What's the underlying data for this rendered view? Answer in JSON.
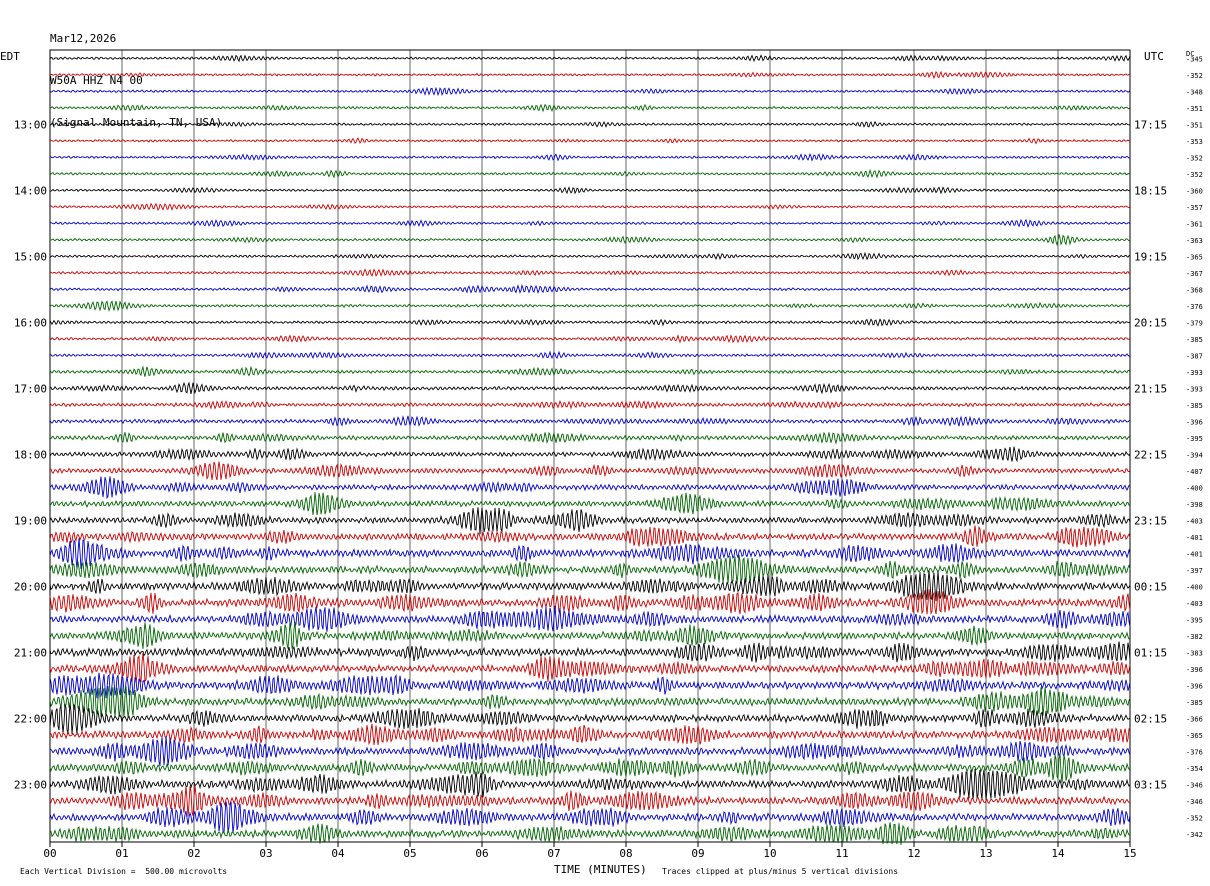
{
  "header": {
    "date": "Mar12,2026",
    "station": "W50A HHZ N4 00",
    "location": "(Signal Mountain, TN, USA)"
  },
  "left_tz_label": "EDT",
  "right_tz_label": "UTC",
  "dc_label": "DC",
  "footer": {
    "scale_note": "Each Vertical Division =  500.00 microvolts",
    "xlabel": "TIME (MINUTES)",
    "clip_note": "Traces clipped at plus/minus 5 vertical divisions"
  },
  "colors": {
    "black": "#000000",
    "red": "#cc0000",
    "blue": "#0000cc",
    "green": "#006600",
    "grid": "#000000"
  },
  "chart_data": {
    "type": "line",
    "title": "",
    "xlabel": "TIME (MINUTES)",
    "xlim": [
      0,
      15
    ],
    "x_ticks": [
      "00",
      "01",
      "02",
      "03",
      "04",
      "05",
      "06",
      "07",
      "08",
      "09",
      "10",
      "11",
      "12",
      "13",
      "14",
      "15"
    ],
    "left_hour_labels": [
      {
        "row": 4,
        "label": "13:00"
      },
      {
        "row": 8,
        "label": "14:00"
      },
      {
        "row": 12,
        "label": "15:00"
      },
      {
        "row": 16,
        "label": "16:00"
      },
      {
        "row": 20,
        "label": "17:00"
      },
      {
        "row": 24,
        "label": "18:00"
      },
      {
        "row": 28,
        "label": "19:00"
      },
      {
        "row": 32,
        "label": "20:00"
      },
      {
        "row": 36,
        "label": "21:00"
      },
      {
        "row": 40,
        "label": "22:00"
      },
      {
        "row": 44,
        "label": "23:00"
      }
    ],
    "right_hour_labels": [
      {
        "row": 4,
        "label": "17:15"
      },
      {
        "row": 8,
        "label": "18:15"
      },
      {
        "row": 12,
        "label": "19:15"
      },
      {
        "row": 16,
        "label": "20:15"
      },
      {
        "row": 20,
        "label": "21:15"
      },
      {
        "row": 24,
        "label": "22:15"
      },
      {
        "row": 28,
        "label": "23:15"
      },
      {
        "row": 32,
        "label": "00:15"
      },
      {
        "row": 36,
        "label": "01:15"
      },
      {
        "row": 40,
        "label": "02:15"
      },
      {
        "row": 44,
        "label": "03:15"
      }
    ],
    "trace_color_cycle": [
      "black",
      "red",
      "blue",
      "green"
    ],
    "dc_offsets": [
      -345,
      -352,
      -348,
      -351,
      -351,
      -353,
      -352,
      -352,
      -360,
      -357,
      -361,
      -363,
      -365,
      -367,
      -368,
      -376,
      -379,
      -385,
      -387,
      -393,
      -393,
      -385,
      -396,
      -395,
      -394,
      -407,
      -400,
      -398,
      -403,
      -401,
      -401,
      -397,
      -400,
      -403,
      -395,
      -382,
      -383,
      -396,
      -396,
      -385,
      -366,
      -365,
      -376,
      -354,
      -346,
      -346,
      -352,
      -342
    ],
    "trace_activity": [
      0.15,
      0.13,
      0.14,
      0.15,
      0.14,
      0.13,
      0.14,
      0.16,
      0.14,
      0.13,
      0.15,
      0.17,
      0.16,
      0.15,
      0.17,
      0.18,
      0.18,
      0.18,
      0.2,
      0.25,
      0.3,
      0.3,
      0.35,
      0.4,
      0.45,
      0.5,
      0.55,
      0.6,
      0.65,
      0.75,
      0.85,
      0.8,
      0.85,
      0.9,
      0.85,
      0.8,
      0.9,
      0.85,
      0.85,
      0.85,
      0.85,
      0.85,
      0.85,
      0.85,
      0.85,
      0.85,
      0.85,
      0.85
    ]
  }
}
